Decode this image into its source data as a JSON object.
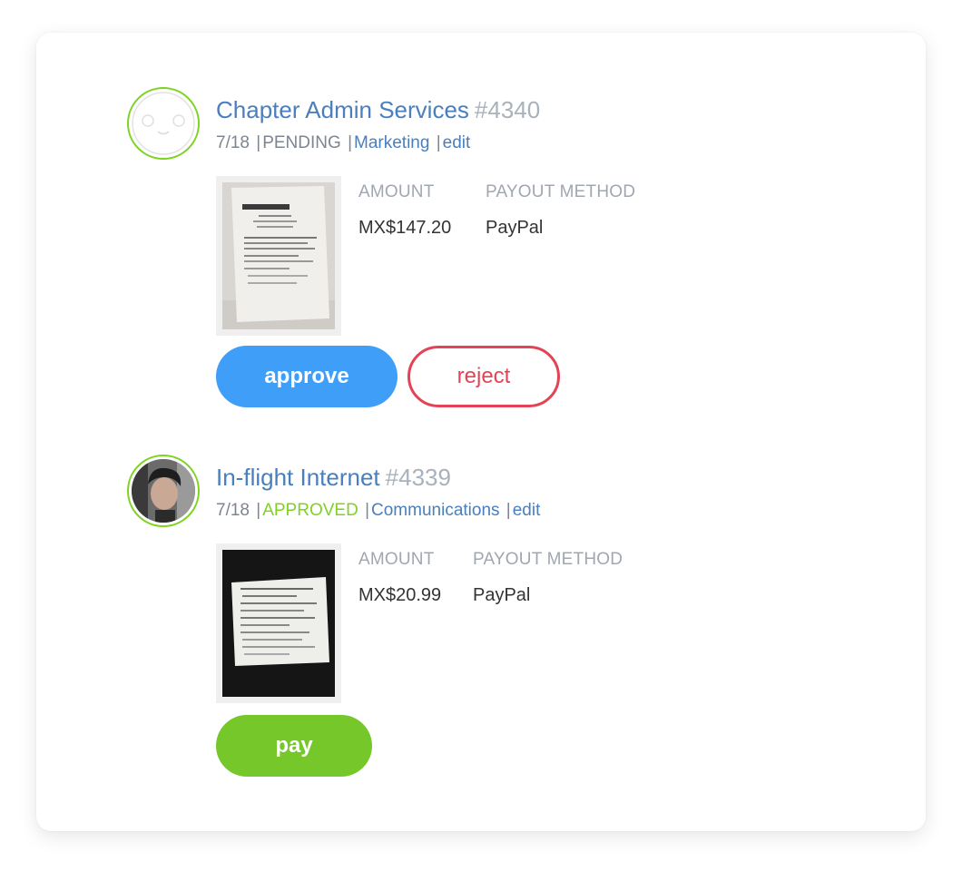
{
  "expenses": [
    {
      "title": "Chapter Admin Services",
      "id": "#4340",
      "date": "7/18",
      "status": "PENDING",
      "category": "Marketing",
      "edit_label": "edit",
      "amount_label": "AMOUNT",
      "amount": "MX$147.20",
      "payout_label": "PAYOUT METHOD",
      "payout": "PayPal",
      "approve_label": "approve",
      "reject_label": "reject"
    },
    {
      "title": "In-flight Internet",
      "id": "#4339",
      "date": "7/18",
      "status": "APPROVED",
      "category": "Communications",
      "edit_label": "edit",
      "amount_label": "AMOUNT",
      "amount": "MX$20.99",
      "payout_label": "PAYOUT METHOD",
      "payout": "PayPal",
      "pay_label": "pay"
    }
  ],
  "colors": {
    "link": "#4a7fbd",
    "muted": "#7d8590",
    "approved": "#7ed321",
    "approve_button": "#3f9ef7",
    "reject": "#e34455",
    "pay_button": "#75c72a"
  },
  "icons": [
    "default-avatar-icon",
    "user-photo-avatar",
    "receipt-thumbnail"
  ]
}
